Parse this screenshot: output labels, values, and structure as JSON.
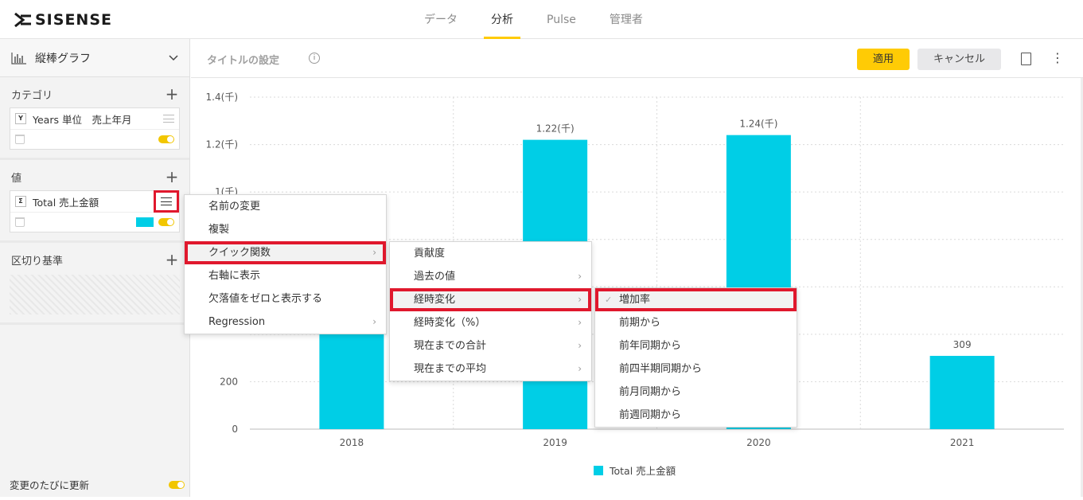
{
  "brand": {
    "logo_text": "SISENSE"
  },
  "nav": {
    "tabs": [
      "データ",
      "分析",
      "Pulse",
      "管理者"
    ],
    "active": "分析"
  },
  "left_panel": {
    "chart_type": "縦棒グラフ",
    "category": {
      "title": "カテゴリ",
      "field_badge": "Y",
      "field_name": "Years 単位　売上年月"
    },
    "values": {
      "title": "値",
      "field_badge": "Σ",
      "field_name": "Total 売上金額",
      "swatch_color": "#00cee6"
    },
    "breakby": {
      "title": "区切り基準"
    },
    "auto_update": "変更のたびに更新"
  },
  "header": {
    "title_placeholder": "タイトルの設定",
    "info": "i",
    "apply": "適用",
    "cancel": "キャンセル"
  },
  "chart_data": {
    "type": "bar",
    "categories": [
      "2018",
      "2019",
      "2020",
      "2021"
    ],
    "series": [
      {
        "name": "Total 売上金額",
        "values": [
          900,
          1220,
          1240,
          309
        ],
        "color": "#00cee6"
      }
    ],
    "data_labels": [
      "",
      "1.22(千)",
      "1.24(千)",
      "309"
    ],
    "y_ticks": [
      "0",
      "200",
      "",
      "",
      "",
      "1(千)",
      "1.2(千)",
      "1.4(千)"
    ],
    "ylim": [
      0,
      1400
    ],
    "grid": true,
    "legend": "bottom"
  },
  "menu_main": {
    "items": [
      {
        "label": "名前の変更",
        "submenu": false
      },
      {
        "label": "複製",
        "submenu": false
      },
      {
        "label": "クイック関数",
        "submenu": true
      },
      {
        "label": "右軸に表示",
        "submenu": false
      },
      {
        "label": "欠落値をゼロと表示する",
        "submenu": false
      },
      {
        "label": "Regression",
        "submenu": true
      }
    ]
  },
  "menu_quick": {
    "items": [
      {
        "label": "貢献度",
        "submenu": false
      },
      {
        "label": "過去の値",
        "submenu": true
      },
      {
        "label": "経時変化",
        "submenu": true
      },
      {
        "label": "経時変化（%）",
        "submenu": true
      },
      {
        "label": "現在までの合計",
        "submenu": true
      },
      {
        "label": "現在までの平均",
        "submenu": true
      }
    ]
  },
  "menu_time": {
    "items": [
      {
        "label": "増加率",
        "checked": true
      },
      {
        "label": "前期から",
        "checked": false
      },
      {
        "label": "前年同期から",
        "checked": false
      },
      {
        "label": "前四半期同期から",
        "checked": false
      },
      {
        "label": "前月同期から",
        "checked": false
      },
      {
        "label": "前週同期から",
        "checked": false
      }
    ]
  }
}
